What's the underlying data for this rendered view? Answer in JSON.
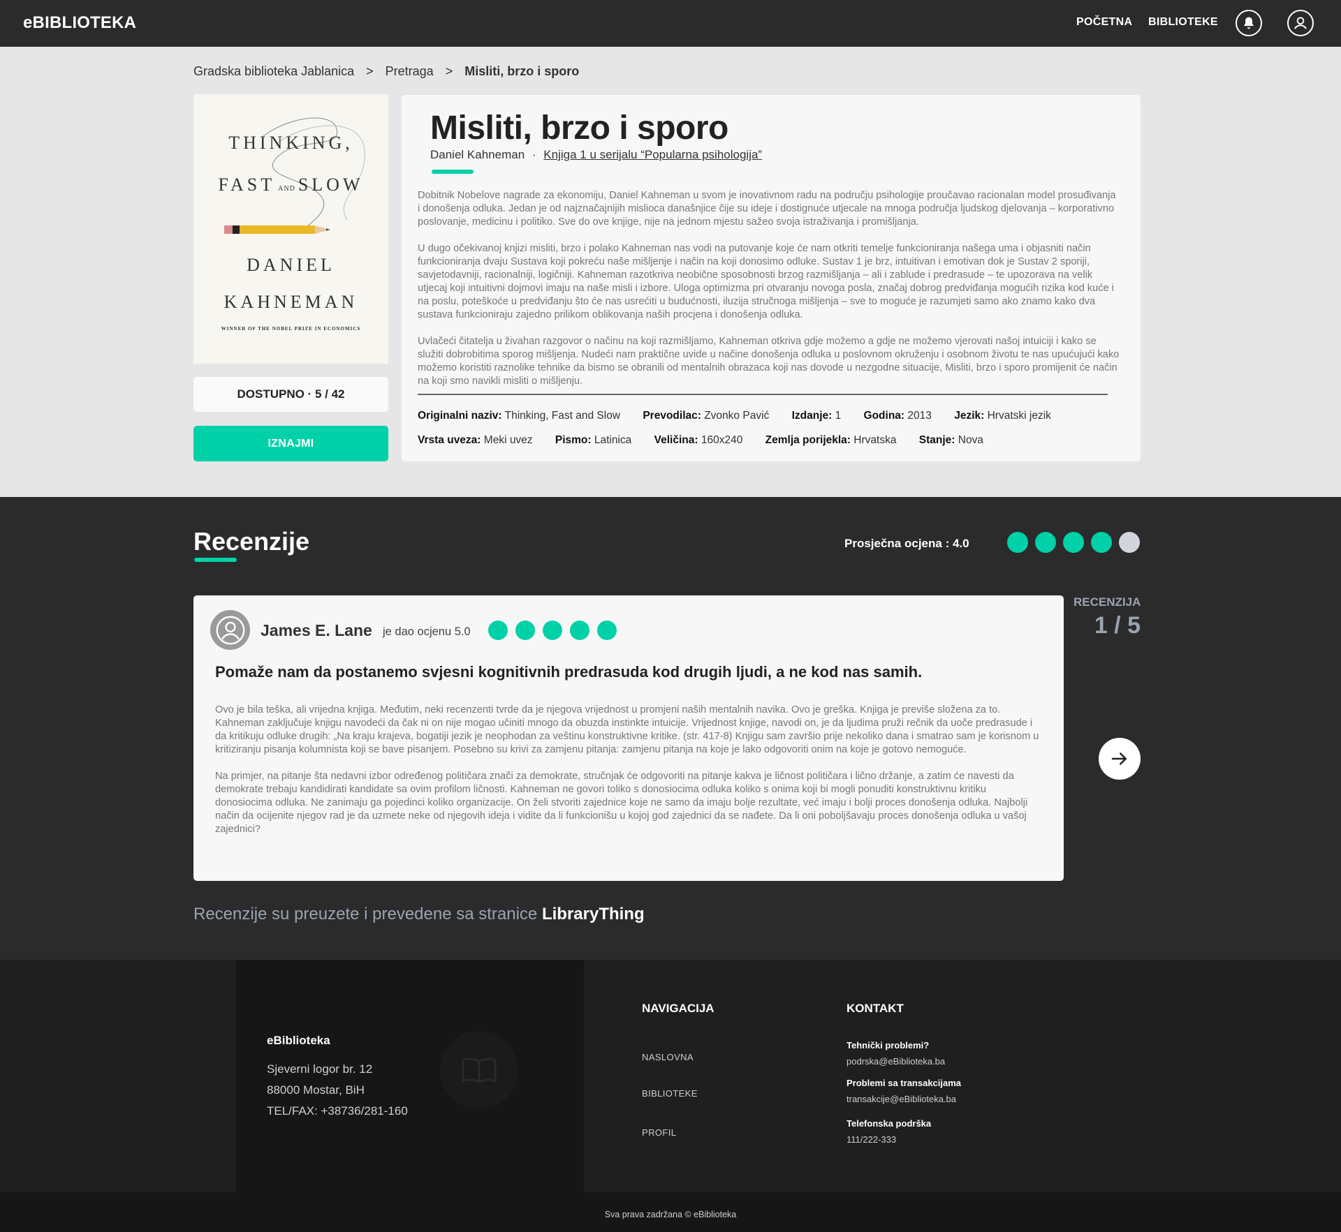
{
  "header": {
    "logo": "eBIBLIOTEKA",
    "nav": [
      "POČETNA",
      "BIBLIOTEKE"
    ]
  },
  "breadcrumb": [
    "Gradska biblioteka Jablanica",
    "Pretraga",
    "Misliti, brzo i sporo"
  ],
  "cover": {
    "line1": "THINKING,",
    "line2a": "FAST",
    "line2and": "AND",
    "line2b": "SLOW",
    "author_first": "DANIEL",
    "author_last": "KAHNEMAN",
    "tagline": "WINNER OF THE NOBEL PRIZE IN ECONOMICS"
  },
  "availability": "DOSTUPNO · 5 / 42",
  "rent_label": "IZNAJMI",
  "book": {
    "title": "Misliti, brzo i sporo",
    "author": "Daniel Kahneman",
    "series": "Knjiga 1 u serijalu “Popularna psihologija”",
    "description": [
      "Dobitnik Nobelove nagrade za ekonomiju, Daniel Kahneman u svom je inovativnom radu na području psihologije proučavao racionalan model prosuđivanja i donošenja odluka. Jedan je od najznačajnijih mislioca današnjice čije su ideje i dostignuće utjecale na mnoga područja ljudskog djelovanja – korporativno poslovanje, medicinu i politiko. Sve do ove knjige, nije na jednom mjestu sažeo svoja istraživanja i promišljanja.",
      "U dugo očekivanoj knjizi misliti, brzo i polako Kahneman nas vodi na putovanje koje će nam otkriti temelje funkcioniranja našega uma i objasniti način funkcioniranja dvaju Sustava koji pokreću naše mišljenje i način na koji donosimo odluke. Sustav 1 je brz, intuitivan i emotivan dok je Sustav 2 sporiji, savjetodavniji, racionalniji, logičniji. Kahneman razotkriva neobične sposobnosti brzog razmišljanja – ali i zablude i predrasude – te upozorava na velik utjecaj koji intuitivni dojmovi imaju na naše misli i izbore. Uloga optimizma pri otvaranju novoga posla, značaj dobrog predviđanja mogućih rizika kod kuće i na poslu, poteškoće u predviđanju što će nas usrećiti u budućnosti, iluzija stručnoga mišljenja – sve to moguće je razumjeti samo ako znamo kako dva sustava funkcioniraju zajedno prilikom oblikovanja naših procjena i donošenja odluka.",
      "Uvlačeći čitatelja u živahan razgovor o načinu na koji razmišljamo, Kahneman otkriva gdje možemo a gdje ne možemo vjerovati našoj intuiciji i kako se služiti dobrobitima sporog mišljenja. Nudeći nam praktične uvide u načine donošenja odluka u poslovnom okruženju i osobnom životu te nas upućujući kako možemo koristiti raznolike tehnike da bismo se obranili od mentalnih obrazaca koji nas dovode u nezgodne situacije, Misliti, brzo i sporo promijenit će način na koji smo navikli misliti o mišljenju."
    ],
    "meta_row1": [
      {
        "label": "Originalni naziv:",
        "value": "Thinking, Fast and Slow"
      },
      {
        "label": "Prevodilac:",
        "value": "Zvonko Pavić"
      },
      {
        "label": "Izdanje:",
        "value": "1"
      },
      {
        "label": "Godina:",
        "value": "2013"
      },
      {
        "label": "Jezik:",
        "value": "Hrvatski jezik"
      }
    ],
    "meta_row2": [
      {
        "label": "Vrsta uveza:",
        "value": "Meki uvez"
      },
      {
        "label": "Pismo:",
        "value": "Latinica"
      },
      {
        "label": "Veličina:",
        "value": "160x240"
      },
      {
        "label": "Zemlja porijekla:",
        "value": "Hrvatska"
      },
      {
        "label": "Stanje:",
        "value": "Nova"
      }
    ]
  },
  "reviews": {
    "title": "Recenzije",
    "average_label": "Prosječna ocjena : 4.0",
    "average_rating": 4,
    "max_rating": 5,
    "colors": {
      "filled": "#00d1a8",
      "empty": "#d3d5de"
    },
    "counter_label": "RECENZIJA",
    "counter": "1 / 5",
    "current": {
      "reviewer": "James E. Lane",
      "rated_text": "je dao ocjenu 5.0",
      "rating": 5,
      "headline": "Pomaže nam da postanemo svjesni kognitivnih predrasuda kod drugih ljudi, a ne kod nas samih.",
      "body": [
        "Ovo je bila teška, ali vrijedna knjiga. Međutim, neki recenzenti tvrde da je njegova vrijednost u promjeni naših mentalnih navika. Ovo je greška. Knjiga je previše složena za to. Kahneman zaključuje knjigu navodeći da čak ni on nije mogao učiniti mnogo da obuzda instinkte intuicije. Vrijednost knjige, navodi on, je da ljudima pruži rečnik da uoče predrasude i da kritikuju odluke drugih: „Na kraju krajeva, bogatiji jezik je neophodan za veštinu konstruktivne kritike. (str. 417-8) Knjigu sam završio prije nekoliko dana i smatrao sam je korisnom u kritiziranju pisanja kolumnista koji se bave pisanjem. Posebno su krivi za zamjenu pitanja: zamjenu pitanja na koje je lako odgovoriti onim na koje je gotovo nemoguće.",
        "Na primjer, na pitanje šta nedavni izbor određenog političara znači za demokrate, stručnjak će odgovoriti na pitanje kakva je ličnost političara i lično držanje, a zatim će navesti da demokrate trebaju kandidirati kandidate sa ovim profilom ličnosti. Kahneman ne govori toliko s donosiocima odluka koliko s onima koji bi mogli ponuditi konstruktivnu kritiku donosiocima odluka. Ne zanimaju ga pojedinci koliko organizacije. On želi stvoriti zajednice koje ne samo da imaju bolje rezultate, već imaju i bolji proces donošenja odluka. Najbolji način da ocijenite njegov rad je da uzmete neke od njegovih ideja i vidite da li funkcionišu u kojoj god zajednici da se nađete. Da li oni poboljšavaju proces donošenja odluka u vašoj zajednici?"
      ]
    },
    "source_text": "Recenzije su preuzete i prevedene sa stranice",
    "source_link": "LibraryThing"
  },
  "footer": {
    "brand": "eBiblioteka",
    "address": [
      "Sjeverni logor br. 12",
      "88000 Mostar, BiH",
      "TEL/FAX: +38736/281-160"
    ],
    "nav_title": "NAVIGACIJA",
    "nav": [
      "NASLOVNA",
      "BIBLIOTEKE",
      "PROFIL"
    ],
    "contact_title": "KONTAKT",
    "contacts": [
      {
        "label": "Tehnički problemi?",
        "value": "podrska@eBiblioteka.ba"
      },
      {
        "label": "Problemi sa transakcijama",
        "value": "transakcije@eBiblioteka.ba"
      },
      {
        "label": "Telefonska podrška",
        "value": "111/222-333"
      }
    ],
    "copyright": "Sva prava zadržana © eBiblioteka"
  }
}
